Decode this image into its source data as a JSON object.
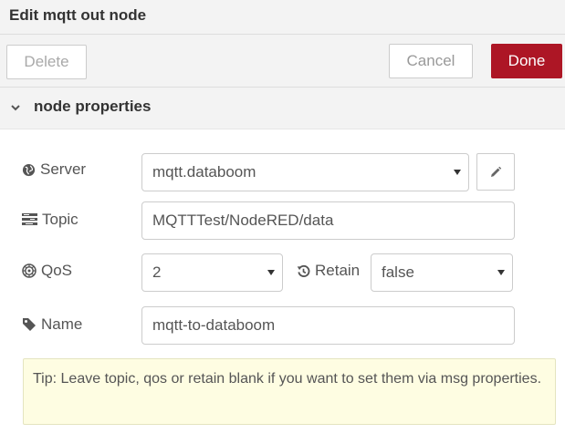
{
  "dialog": {
    "title": "Edit mqtt out node"
  },
  "toolbar": {
    "delete_label": "Delete",
    "cancel_label": "Cancel",
    "done_label": "Done",
    "done_color": "#ad1625"
  },
  "section": {
    "title": "node properties",
    "icon": "chevron-down-icon"
  },
  "form": {
    "server": {
      "label": "Server",
      "icon": "globe-icon",
      "value": "mqtt.databoom",
      "edit_icon": "pencil-icon"
    },
    "topic": {
      "label": "Topic",
      "icon": "tasks-icon",
      "value": "MQTTTest/NodeRED/data"
    },
    "qos": {
      "label": "QoS",
      "icon": "empire-icon",
      "value": "2"
    },
    "retain": {
      "label": "Retain",
      "icon": "history-icon",
      "value": "false"
    },
    "name": {
      "label": "Name",
      "icon": "tag-icon",
      "value": "mqtt-to-databoom"
    }
  },
  "tip": {
    "text": "Tip: Leave topic, qos or retain blank if you want to set them via msg properties.",
    "background": "#fefde2"
  }
}
